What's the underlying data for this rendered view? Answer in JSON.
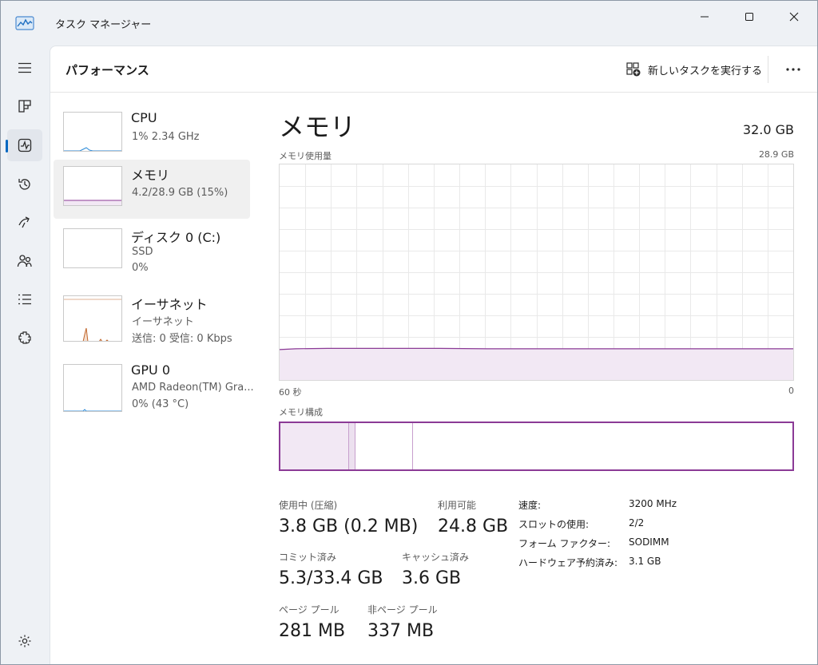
{
  "window": {
    "title": "タスク マネージャー",
    "app_icon": "task-manager-icon"
  },
  "nav": {
    "items": [
      {
        "name": "hamburger-icon"
      },
      {
        "name": "processes-icon"
      },
      {
        "name": "performance-icon",
        "active": true
      },
      {
        "name": "app-history-icon"
      },
      {
        "name": "startup-apps-icon"
      },
      {
        "name": "users-icon"
      },
      {
        "name": "details-icon"
      },
      {
        "name": "services-icon"
      }
    ],
    "settings": "gear-icon"
  },
  "header": {
    "title": "パフォーマンス",
    "run_task": "新しいタスクを実行する"
  },
  "resources": [
    {
      "name": "CPU",
      "line1": "1%  2.34 GHz",
      "line2": ""
    },
    {
      "name": "メモリ",
      "line1": "4.2/28.9 GB (15%)",
      "line2": "",
      "selected": true
    },
    {
      "name": "ディスク 0 (C:)",
      "line1": "SSD",
      "line2": "0%"
    },
    {
      "name": "イーサネット",
      "line1": "イーサネット",
      "line2": "送信: 0  受信: 0 Kbps"
    },
    {
      "name": "GPU 0",
      "line1": "AMD Radeon(TM) Gra...",
      "line2": "0% (43 °C)"
    }
  ],
  "detail": {
    "title": "メモリ",
    "total": "32.0 GB",
    "usage_label": "メモリ使用量",
    "usage_max": "28.9 GB",
    "time_left": "60 秒",
    "time_right": "0",
    "composition_label": "メモリ構成",
    "usage_fraction": 0.145,
    "stats": {
      "in_use_label": "使用中 (圧縮)",
      "in_use_value": "3.8 GB (0.2 MB)",
      "available_label": "利用可能",
      "available_value": "24.8 GB",
      "committed_label": "コミット済み",
      "committed_value": "5.3/33.4 GB",
      "cached_label": "キャッシュ済み",
      "cached_value": "3.6 GB",
      "paged_label": "ページ プール",
      "paged_value": "281 MB",
      "nonpaged_label": "非ページ プール",
      "nonpaged_value": "337 MB"
    },
    "props": [
      {
        "label": "速度:",
        "value": "3200 MHz"
      },
      {
        "label": "スロットの使用:",
        "value": "2/2"
      },
      {
        "label": "フォーム ファクター:",
        "value": "SODIMM"
      },
      {
        "label": "ハードウェア予約済み:",
        "value": "3.1 GB"
      }
    ]
  },
  "colors": {
    "memory_accent": "#8b3a96",
    "memory_fill": "#f2e8f4",
    "cpu_line": "#2b8ad8",
    "disk_line": "#4caf50",
    "net_line": "#c0652a",
    "nav_indicator": "#0067c0"
  }
}
